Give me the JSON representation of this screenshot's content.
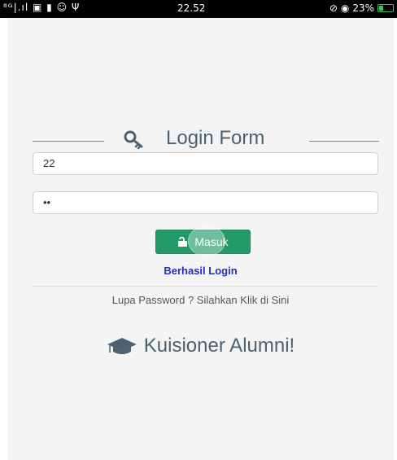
{
  "status_bar": {
    "left_icons": "⁸ᴳ|.ıl ▣ ▮ ☺ Ψ",
    "time": "22.52",
    "battery_text": "23%",
    "right_icons": "⊘ ◉"
  },
  "login": {
    "title": "Login Form",
    "title_icon": "key-icon",
    "username_value": "22",
    "password_value": "••",
    "submit_label": "Masuk",
    "submit_icon": "unlock-icon",
    "success_message": "Berhasil Login",
    "forgot_text": "Lupa Password ? Silahkan Klik di Sini"
  },
  "brand": {
    "text": "Kuisioner Alumni!",
    "icon": "graduation-cap-icon"
  },
  "colors": {
    "button": "#239a67",
    "message": "#1f2fb8",
    "title": "#4d6170",
    "background": "#f4f4f4"
  }
}
